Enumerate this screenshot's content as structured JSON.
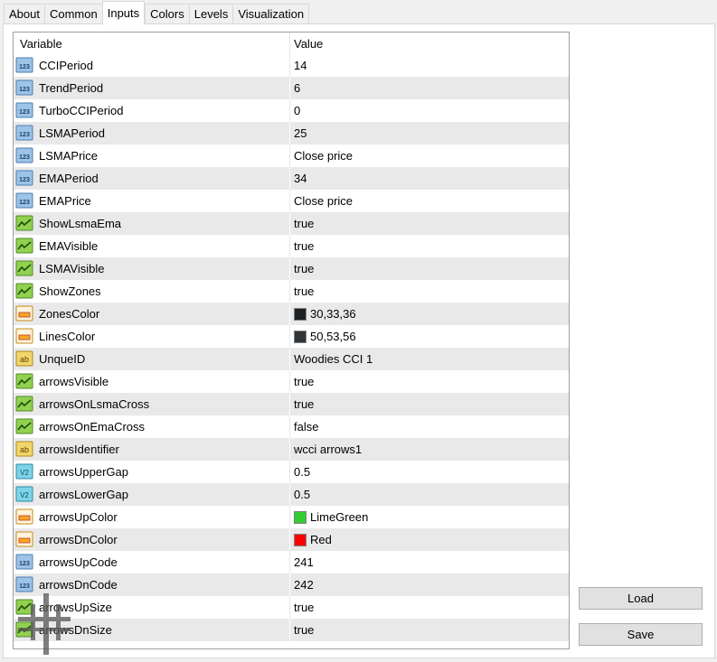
{
  "tabs": [
    {
      "label": "About"
    },
    {
      "label": "Common"
    },
    {
      "label": "Inputs",
      "active": true
    },
    {
      "label": "Colors"
    },
    {
      "label": "Levels"
    },
    {
      "label": "Visualization"
    }
  ],
  "grid": {
    "header": {
      "variable": "Variable",
      "value": "Value"
    },
    "rows": [
      {
        "name": "CCIPeriod",
        "value": "14",
        "icon": "integer-icon"
      },
      {
        "name": "TrendPeriod",
        "value": "6",
        "icon": "integer-icon"
      },
      {
        "name": "TurboCCIPeriod",
        "value": "0",
        "icon": "integer-icon"
      },
      {
        "name": "LSMAPeriod",
        "value": "25",
        "icon": "integer-icon"
      },
      {
        "name": "LSMAPrice",
        "value": "Close price",
        "icon": "integer-icon"
      },
      {
        "name": "EMAPeriod",
        "value": "34",
        "icon": "integer-icon"
      },
      {
        "name": "EMAPrice",
        "value": "Close price",
        "icon": "integer-icon"
      },
      {
        "name": "ShowLsmaEma",
        "value": "true",
        "icon": "boolean-icon"
      },
      {
        "name": "EMAVisible",
        "value": "true",
        "icon": "boolean-icon"
      },
      {
        "name": "LSMAVisible",
        "value": "true",
        "icon": "boolean-icon"
      },
      {
        "name": "ShowZones",
        "value": "true",
        "icon": "boolean-icon"
      },
      {
        "name": "ZonesColor",
        "value": "30,33,36",
        "icon": "color-icon",
        "swatch": "#1e2124"
      },
      {
        "name": "LinesColor",
        "value": "50,53,56",
        "icon": "color-icon",
        "swatch": "#323538"
      },
      {
        "name": "UnqueID",
        "value": "Woodies CCI 1",
        "icon": "string-icon"
      },
      {
        "name": "arrowsVisible",
        "value": "true",
        "icon": "boolean-icon"
      },
      {
        "name": "arrowsOnLsmaCross",
        "value": "true",
        "icon": "boolean-icon"
      },
      {
        "name": "arrowsOnEmaCross",
        "value": "false",
        "icon": "boolean-icon"
      },
      {
        "name": "arrowsIdentifier",
        "value": "wcci arrows1",
        "icon": "string-icon"
      },
      {
        "name": "arrowsUpperGap",
        "value": "0.5",
        "icon": "double-icon"
      },
      {
        "name": "arrowsLowerGap",
        "value": "0.5",
        "icon": "double-icon"
      },
      {
        "name": "arrowsUpColor",
        "value": "LimeGreen",
        "icon": "color-icon",
        "swatch": "#32cd32"
      },
      {
        "name": "arrowsDnColor",
        "value": "Red",
        "icon": "color-icon",
        "swatch": "#ff0000"
      },
      {
        "name": "arrowsUpCode",
        "value": "241",
        "icon": "integer-icon"
      },
      {
        "name": "arrowsDnCode",
        "value": "242",
        "icon": "integer-icon"
      },
      {
        "name": "arrowsUpSize",
        "value": "true",
        "icon": "boolean-icon"
      },
      {
        "name": "arrowsDnSize",
        "value": "true",
        "icon": "boolean-icon"
      }
    ]
  },
  "buttons": {
    "load": "Load",
    "save": "Save"
  },
  "icon_glyphs": {
    "integer-icon": "123",
    "string-icon": "ab",
    "double-icon": "V2"
  },
  "colors": {
    "integer": "#9dc3e6",
    "boolean": "#92d050",
    "color": "#f5a623",
    "string": "#f2d56b",
    "double": "#7fd3e8",
    "row_alt": "#e9e9e9"
  }
}
